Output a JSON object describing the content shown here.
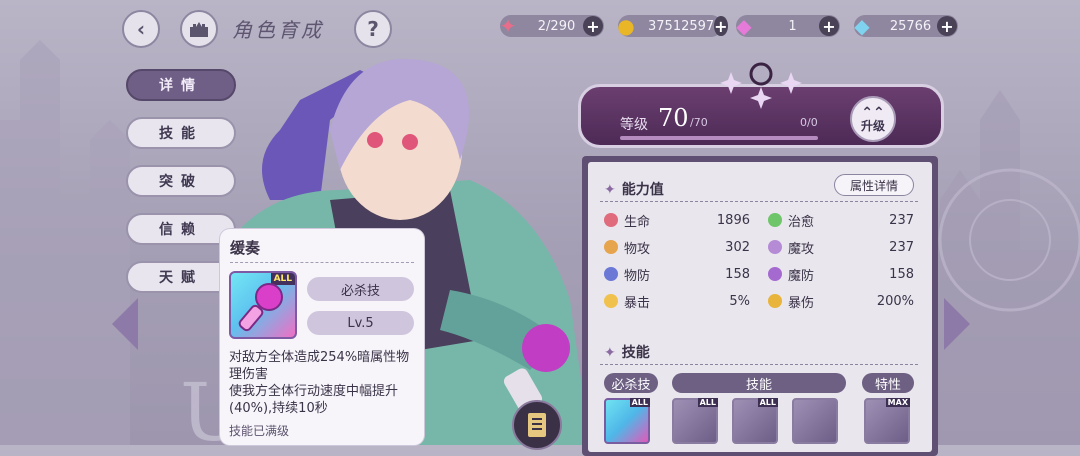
{
  "header": {
    "title": "角色育成",
    "back_icon": "back-arrow-icon",
    "home_icon": "castle-home-icon",
    "help_label": "?"
  },
  "resources": [
    {
      "icon": "candy-icon",
      "value": "2/290"
    },
    {
      "icon": "gold-coin-icon",
      "value": "37512597"
    },
    {
      "icon": "pink-gem-icon",
      "value": "1"
    },
    {
      "icon": "blue-diamond-icon",
      "value": "25766"
    }
  ],
  "menu": [
    {
      "label": "详情",
      "active": true
    },
    {
      "label": "技能",
      "active": false
    },
    {
      "label": "突破",
      "active": false
    },
    {
      "label": "信赖",
      "active": false
    },
    {
      "label": "天赋",
      "active": false
    }
  ],
  "level": {
    "label": "等级",
    "value": "70",
    "max": "/70",
    "exp": "0/0",
    "upgrade_label": "升级"
  },
  "stats_section": {
    "title": "能力值",
    "detail_button": "属性详情",
    "items": [
      {
        "label": "生命",
        "value": "1896",
        "color": "#e06b7d"
      },
      {
        "label": "治愈",
        "value": "237",
        "color": "#6fc56a"
      },
      {
        "label": "物攻",
        "value": "302",
        "color": "#e6a44d"
      },
      {
        "label": "魔攻",
        "value": "237",
        "color": "#b58bd6"
      },
      {
        "label": "物防",
        "value": "158",
        "color": "#6b78d6"
      },
      {
        "label": "魔防",
        "value": "158",
        "color": "#a46ad0"
      },
      {
        "label": "暴击",
        "value": "5%",
        "color": "#f0c24d"
      },
      {
        "label": "暴伤",
        "value": "200%",
        "color": "#e8b43c"
      }
    ]
  },
  "skills_section": {
    "title": "技能",
    "headers": [
      "必杀技",
      "技能",
      "特性"
    ],
    "tags": [
      "ALL",
      "ALL",
      "ALL",
      "MAX"
    ]
  },
  "popup": {
    "title": "缓奏",
    "icon_tag": "ALL",
    "type_chip": "必杀技",
    "level_chip": "Lv.5",
    "desc_lines": [
      "对敌方全体造成254%暗属性物",
      "理伤害",
      "使我方全体行动速度中幅提升",
      "(40%),持续10秒"
    ],
    "footer": "技能已满级"
  }
}
